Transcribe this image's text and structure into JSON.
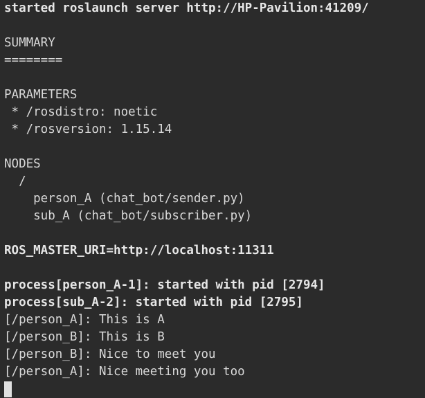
{
  "terminal": {
    "lines": [
      {
        "text": "started roslaunch server http://HP-Pavilion:41209/",
        "bold": true
      },
      {
        "text": "",
        "bold": false
      },
      {
        "text": "SUMMARY",
        "bold": false
      },
      {
        "text": "========",
        "bold": false
      },
      {
        "text": "",
        "bold": false
      },
      {
        "text": "PARAMETERS",
        "bold": false
      },
      {
        "text": " * /rosdistro: noetic",
        "bold": false
      },
      {
        "text": " * /rosversion: 1.15.14",
        "bold": false
      },
      {
        "text": "",
        "bold": false
      },
      {
        "text": "NODES",
        "bold": false
      },
      {
        "text": "  /",
        "bold": false
      },
      {
        "text": "    person_A (chat_bot/sender.py)",
        "bold": false
      },
      {
        "text": "    sub_A (chat_bot/subscriber.py)",
        "bold": false
      },
      {
        "text": "",
        "bold": false
      },
      {
        "text": "ROS_MASTER_URI=http://localhost:11311",
        "bold": true
      },
      {
        "text": "",
        "bold": false
      },
      {
        "text": "process[person_A-1]: started with pid [2794]",
        "bold": true
      },
      {
        "text": "process[sub_A-2]: started with pid [2795]",
        "bold": true
      },
      {
        "text": "[/person_A]: This is A",
        "bold": false
      },
      {
        "text": "[/person_B]: This is B",
        "bold": false
      },
      {
        "text": "[/person_B]: Nice to meet you",
        "bold": false
      },
      {
        "text": "[/person_A]: Nice meeting you too",
        "bold": false
      }
    ]
  },
  "colors": {
    "background": "#2b2b2b",
    "foreground": "#d9d9d9",
    "cursor": "#e0e0e0"
  }
}
